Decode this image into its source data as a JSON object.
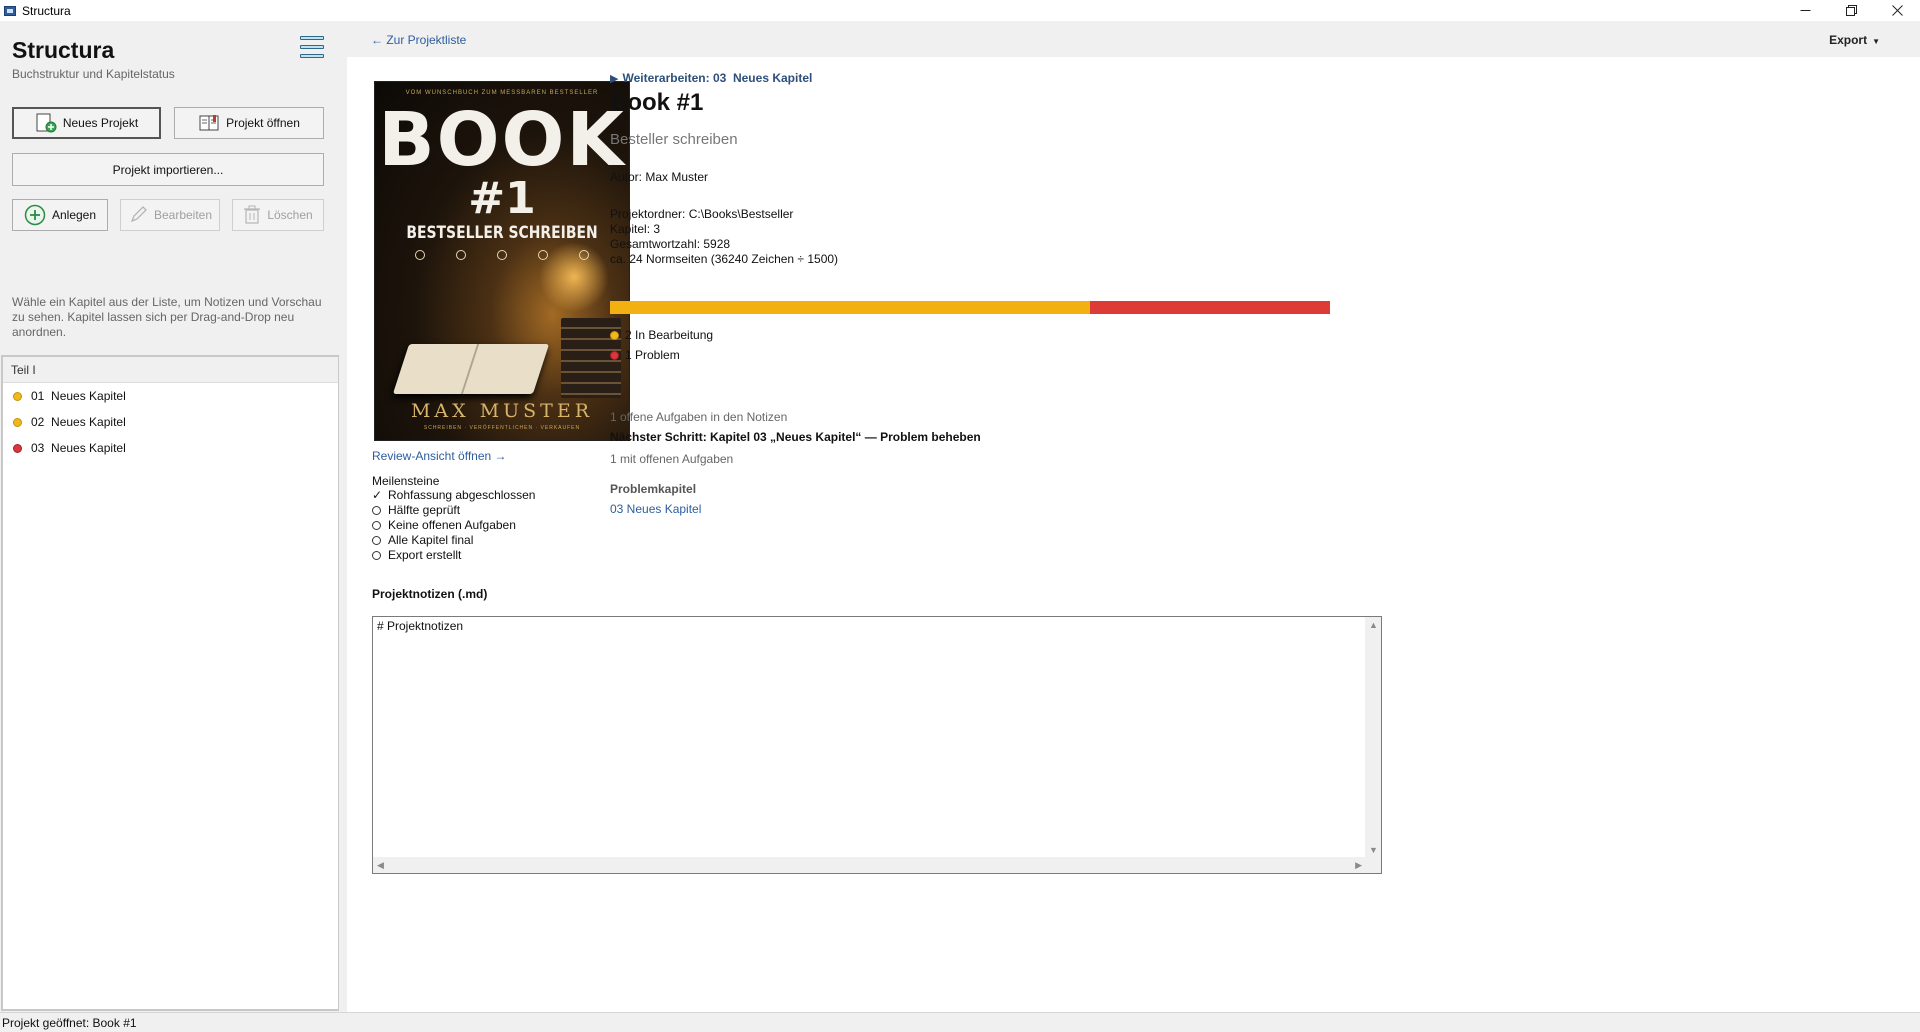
{
  "window": {
    "title": "Structura",
    "controls": [
      "minimize-icon",
      "restore-icon",
      "close-icon"
    ]
  },
  "sidebar": {
    "app_name": "Structura",
    "app_subtitle": "Buchstruktur und Kapitelstatus",
    "buttons": {
      "new_project": "Neues Projekt",
      "open_project": "Projekt öffnen",
      "import_project": "Projekt importieren...",
      "create": "Anlegen",
      "edit": "Bearbeiten",
      "delete": "Löschen"
    },
    "hint": "Wähle ein Kapitel aus der Liste, um Notizen und Vorschau zu sehen. Kapitel lassen sich per Drag-and-Drop neu anordnen.",
    "tree": {
      "part": "Teil I",
      "chapters": [
        {
          "number": "01",
          "title": "Neues Kapitel",
          "status": "in-progress"
        },
        {
          "number": "02",
          "title": "Neues Kapitel",
          "status": "in-progress"
        },
        {
          "number": "03",
          "title": "Neues Kapitel",
          "status": "problem"
        }
      ]
    }
  },
  "main": {
    "back_link": "← Zur Projektliste",
    "export_label": "Export",
    "continue": {
      "label": "Weiterarbeiten: 03",
      "chapter": "Neues Kapitel"
    },
    "book_title": "Book #1",
    "book_subtitle": "Besteller schreiben",
    "author": "Autor: Max Muster",
    "info": {
      "folder": "Projektordner: C:\\Books\\Bestseller",
      "chapters": "Kapitel: 3",
      "word_count": "Gesamtwortzahl: 5928",
      "pages": "ca. 24 Normseiten (36240 Zeichen ÷ 1500)"
    },
    "progress": {
      "segments": [
        {
          "label": "In Bearbeitung",
          "count": 2,
          "fraction": 0.667,
          "color": "#f2b111"
        },
        {
          "label": "Problem",
          "count": 1,
          "fraction": 0.333,
          "color": "#dc3b36"
        }
      ],
      "legend": [
        "2 In Bearbeitung",
        "1 Problem"
      ]
    },
    "tasks_open": "1 offene Aufgaben in den Notizen",
    "next_step": "Nächster Schritt: Kapitel 03 „Neues Kapitel“ — Problem beheben",
    "tasks_count": "1 mit offenen Aufgaben",
    "problem_title": "Problemkapitel",
    "problem_link": "03  Neues Kapitel",
    "cover": {
      "top_line": "VOM WUNSCHBUCH ZUM MESSBAREN BESTSELLER",
      "title": "BOOK",
      "number": "#1",
      "subtitle": "BESTSELLER SCHREIBEN",
      "author": "MAX MUSTER",
      "tagline": "SCHREIBEN · VERÖFFENTLICHEN · VERKAUFEN"
    },
    "review_link": "Review-Ansicht öffnen →",
    "milestones_title": "Meilensteine",
    "milestones": [
      {
        "label": "Rohfassung abgeschlossen",
        "done": true
      },
      {
        "label": "Hälfte geprüft",
        "done": false
      },
      {
        "label": "Keine offenen Aufgaben",
        "done": false
      },
      {
        "label": "Alle Kapitel final",
        "done": false
      },
      {
        "label": "Export erstellt",
        "done": false
      }
    ],
    "notes_title": "Projektnotizen (.md)",
    "notes_content": "# Projektnotizen"
  },
  "status_bar": "Projekt geöffnet: Book #1",
  "colors": {
    "accent_link": "#2d5d9e",
    "in_progress": "#f2b111",
    "problem": "#dc3b36"
  }
}
